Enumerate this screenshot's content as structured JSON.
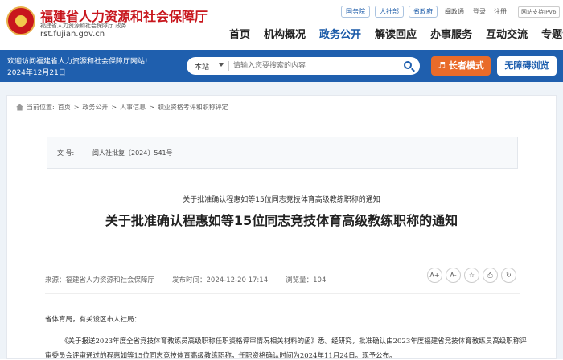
{
  "header": {
    "site_name": "福建省人力资源和社会保障厅",
    "site_sub": "福建省人力资源和社会保障厅 政务",
    "site_url": "rst.fujian.gov.cn",
    "top_links": [
      "国务院",
      "人社部",
      "省政府"
    ],
    "util_links": [
      "闽政通",
      "登录",
      "注册"
    ],
    "ipv6": "网站支持IPV6",
    "nav": [
      "首页",
      "机构概况",
      "政务公开",
      "解读回应",
      "办事服务",
      "互动交流",
      "专题专栏"
    ],
    "nav_active": "政务公开"
  },
  "band": {
    "welcome": "欢迎访问福建省人力资源和社会保障厅网站!",
    "date": "2024年12月21日",
    "search_scope": "本站",
    "search_placeholder": "请输入您要搜索的内容",
    "elder_mode": "长者模式",
    "accessibility": "无障碍浏览"
  },
  "breadcrumb": {
    "label": "当前位置:",
    "items": [
      "首页",
      "政务公开",
      "人事信息",
      "职业资格考评和职称评定"
    ]
  },
  "doc": {
    "number_label": "文 号:",
    "number_value": "闽人社批复〔2024〕541号",
    "subtitle": "关于批准确认程惠如等15位同志竞技体育高级教练职称的通知",
    "title": "关于批准确认程惠如等15位同志竞技体育高级教练职称的通知",
    "source": "来源：福建省人力资源和社会保障厅",
    "published": "发布时间：2024-12-20 17:14",
    "views": "浏览量：104",
    "salutation": "省体育局，有关设区市人社局：",
    "body_line": "《关于报送2023年度全省竞技体育教练员高级职称任职资格评审情况相关材料的函》悉。经研究，批准确认由2023年度福建省竞技体育教练员高级职称评",
    "body_line2": "审委员会评审通过的程惠如等15位同志竞技体育高级教练职称，任职资格确认时间为2024年11月24日。现予公布。"
  },
  "tools": [
    "A+",
    "A-",
    "star",
    "print",
    "share"
  ]
}
